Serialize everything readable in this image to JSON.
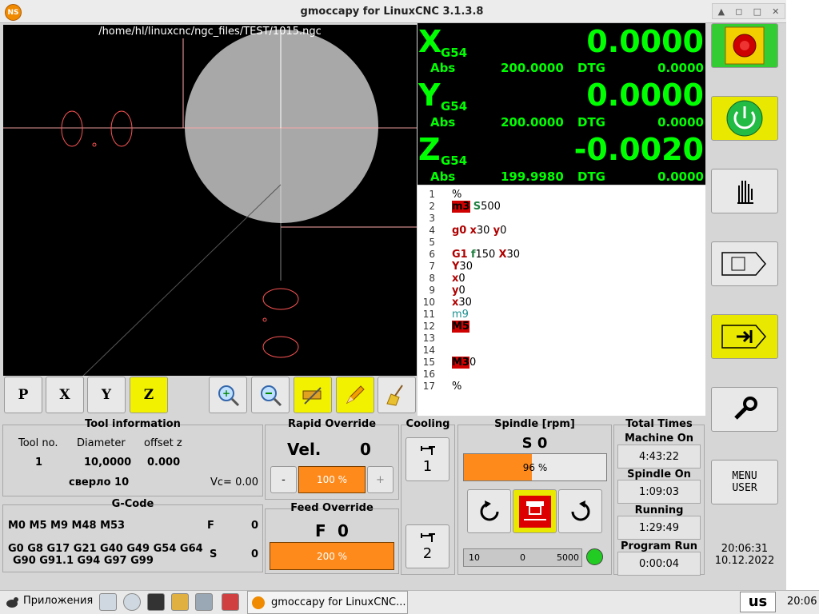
{
  "window": {
    "title": "gmoccapy for LinuxCNC  3.1.3.8",
    "app_icon": "NS"
  },
  "preview": {
    "file": "/home/hl/linuxcnc/ngc_files/TEST/1015.ngc"
  },
  "dro": {
    "x": {
      "axis": "X",
      "coord": "G54",
      "value": "0.0000",
      "abs_label": "Abs",
      "abs": "200.0000",
      "dtg_label": "DTG",
      "dtg": "0.0000"
    },
    "y": {
      "axis": "Y",
      "coord": "G54",
      "value": "0.0000",
      "abs_label": "Abs",
      "abs": "200.0000",
      "dtg_label": "DTG",
      "dtg": "0.0000"
    },
    "z": {
      "axis": "Z",
      "coord": "G54",
      "value": "-0.0020",
      "abs_label": "Abs",
      "abs": "199.9980",
      "dtg_label": "DTG",
      "dtg": "0.0000"
    }
  },
  "gcode_lines": [
    {
      "n": "1",
      "parts": [
        [
          "",
          "%"
        ]
      ]
    },
    {
      "n": "2",
      "parts": [
        [
          "kwbg",
          "m3"
        ],
        [
          "",
          " "
        ],
        [
          "gr",
          "S"
        ],
        [
          "",
          "500"
        ]
      ]
    },
    {
      "n": "3",
      "parts": []
    },
    {
      "n": "4",
      "parts": [
        [
          "kw",
          "g0"
        ],
        [
          "",
          " "
        ],
        [
          "kw",
          "x"
        ],
        [
          "",
          "30 "
        ],
        [
          "kw",
          "y"
        ],
        [
          "",
          "0"
        ]
      ]
    },
    {
      "n": "5",
      "parts": []
    },
    {
      "n": "6",
      "parts": [
        [
          "kw",
          "G1"
        ],
        [
          "",
          " "
        ],
        [
          "gr",
          "f"
        ],
        [
          "",
          "150 "
        ],
        [
          "kw",
          "X"
        ],
        [
          "",
          "30"
        ]
      ]
    },
    {
      "n": "7",
      "parts": [
        [
          "kw",
          "Y"
        ],
        [
          "",
          "30"
        ]
      ]
    },
    {
      "n": "8",
      "parts": [
        [
          "kw",
          "x"
        ],
        [
          "",
          "0"
        ]
      ]
    },
    {
      "n": "9",
      "parts": [
        [
          "kw",
          "y"
        ],
        [
          "",
          "0"
        ]
      ]
    },
    {
      "n": "10",
      "parts": [
        [
          "kw",
          "x"
        ],
        [
          "",
          "30"
        ]
      ]
    },
    {
      "n": "11",
      "parts": [
        [
          "cy",
          "m9"
        ]
      ]
    },
    {
      "n": "12",
      "parts": [
        [
          "kwbg",
          "M5"
        ]
      ]
    },
    {
      "n": "13",
      "parts": []
    },
    {
      "n": "14",
      "parts": []
    },
    {
      "n": "15",
      "parts": [
        [
          "kwbg",
          "M3"
        ],
        [
          "",
          "0"
        ]
      ]
    },
    {
      "n": "16",
      "parts": []
    },
    {
      "n": "17",
      "parts": [
        [
          "",
          "%"
        ]
      ]
    }
  ],
  "tool_info": {
    "title": "Tool information",
    "col_tool": "Tool no.",
    "col_diameter": "Diameter",
    "col_offset": "offset z",
    "tool": "1",
    "diameter": "10,0000",
    "offset": "0.000",
    "description": "сверло 10",
    "vc": "Vc= 0.00"
  },
  "gcode_state": {
    "title": "G-Code",
    "mcodes": "M0 M5 M9 M48 M53",
    "f_label": "F",
    "f_value": "0",
    "gcodes_1": "G0 G8 G17 G21 G40 G49 G54 G64",
    "gcodes_2": "G90 G91.1 G94 G97 G99",
    "s_label": "S",
    "s_value": "0"
  },
  "rapid_override": {
    "title": "Rapid Override",
    "vel_label": "Vel.",
    "vel_value": "0",
    "minus": "-",
    "plus": "+",
    "percent": "100 %",
    "fraction": 1.0
  },
  "feed_override": {
    "title": "Feed Override",
    "f_label": "F",
    "f_value": "0",
    "percent": "200 %",
    "fraction": 1.0
  },
  "cooling": {
    "title": "Cooling",
    "btn1": "1",
    "btn2": "2"
  },
  "spindle": {
    "title": "Spindle [rpm]",
    "speed": "S 0",
    "override": "96 %",
    "override_fraction": 0.48,
    "scale_min": "10",
    "scale_mid": "0",
    "scale_max": "5000",
    "led_color": "#22cc22"
  },
  "total_times": {
    "title": "Total Times",
    "machine_on_label": "Machine On",
    "machine_on": "4:43:22",
    "spindle_on_label": "Spindle On",
    "spindle_on": "1:09:03",
    "running_label": "Running",
    "running": "1:29:49",
    "program_run_label": "Program Run",
    "program_run": "0:00:04"
  },
  "right_buttons": {
    "menu_user_1": "MENU",
    "menu_user_2": "USER"
  },
  "clock": {
    "time": "20:06:31",
    "date": "10.12.2022"
  },
  "taskbar": {
    "apps_label": "Приложения",
    "task_label": "gmoccapy for LinuxCNC...",
    "layout": "us",
    "time": "20:06"
  },
  "colors": {
    "dro_text": "#00ff00",
    "accent_yellow": "#e8e800",
    "orange": "#ff8a1c",
    "estop_green": "#33cc33"
  }
}
